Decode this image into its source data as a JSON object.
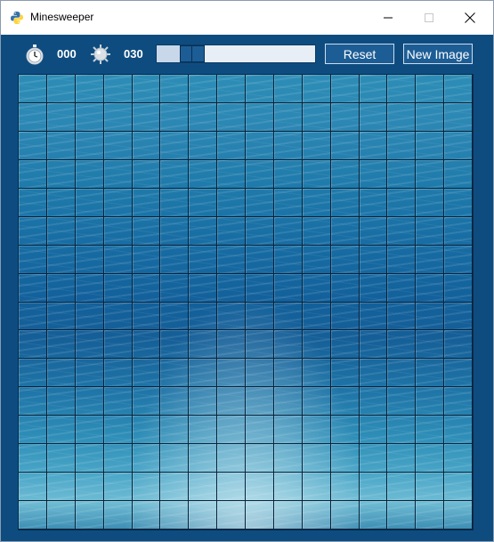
{
  "window": {
    "title": "Minesweeper"
  },
  "toolbar": {
    "timer_icon": "stopwatch-icon",
    "timer_value": "000",
    "mine_icon": "mine-icon",
    "mines_value": "030",
    "slider_value": 0.17,
    "reset_label": "Reset",
    "new_image_label": "New Image"
  },
  "board": {
    "rows": 16,
    "columns": 16,
    "cell_state": "covered"
  },
  "colors": {
    "background": "#0e4c80",
    "button": "#1d5d95",
    "text": "#ffffff"
  }
}
